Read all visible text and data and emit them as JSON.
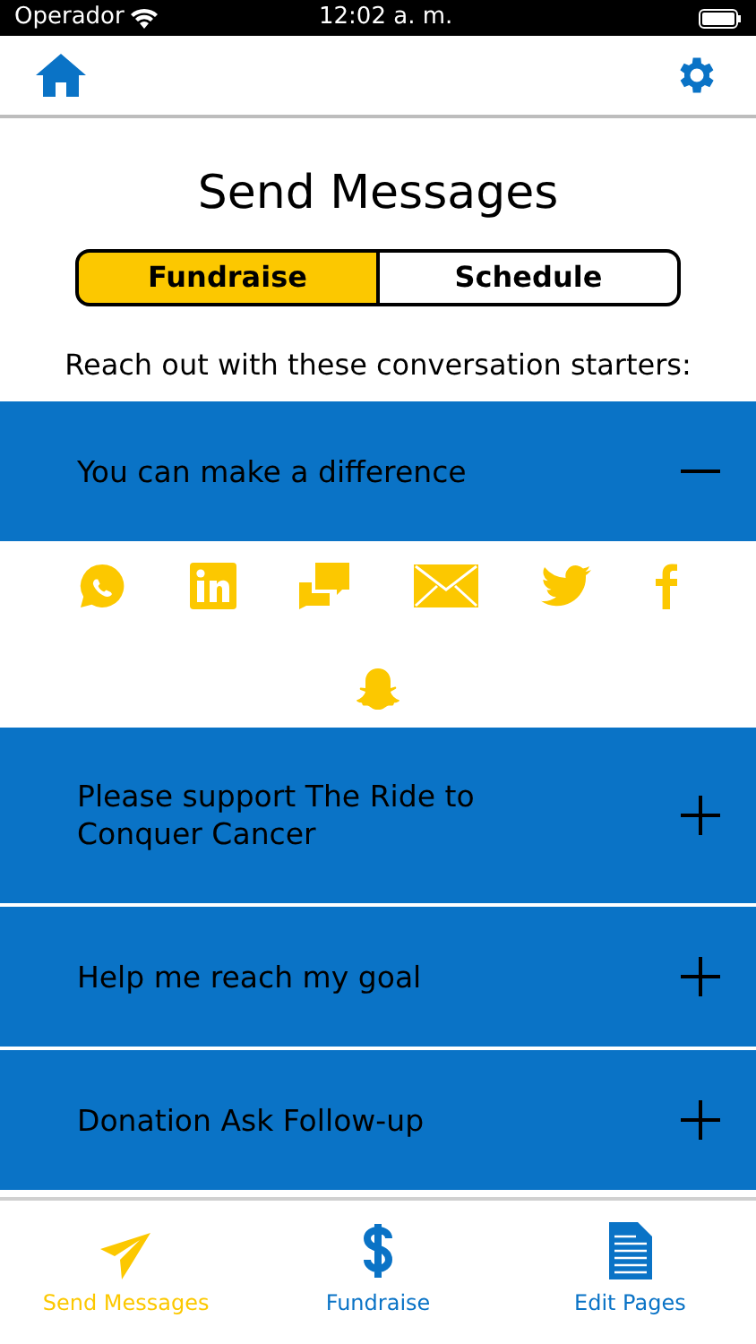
{
  "status_bar": {
    "carrier": "Operador",
    "time": "12:02 a. m."
  },
  "title": "Send Messages",
  "segments": [
    {
      "label": "Fundraise",
      "selected": true
    },
    {
      "label": "Schedule",
      "selected": false
    }
  ],
  "intro": "Reach out with these conversation starters:",
  "messages": [
    {
      "title": "You can make a difference",
      "expanded": true
    },
    {
      "title": "Please support The Ride to Conquer Cancer",
      "expanded": false
    },
    {
      "title": "Help me reach my goal",
      "expanded": false
    },
    {
      "title": "Donation Ask Follow-up",
      "expanded": false
    }
  ],
  "tab_bar": [
    {
      "label": "Send Messages",
      "selected": true
    },
    {
      "label": "Fundraise",
      "selected": false
    },
    {
      "label": "Edit Pages",
      "selected": false
    }
  ]
}
